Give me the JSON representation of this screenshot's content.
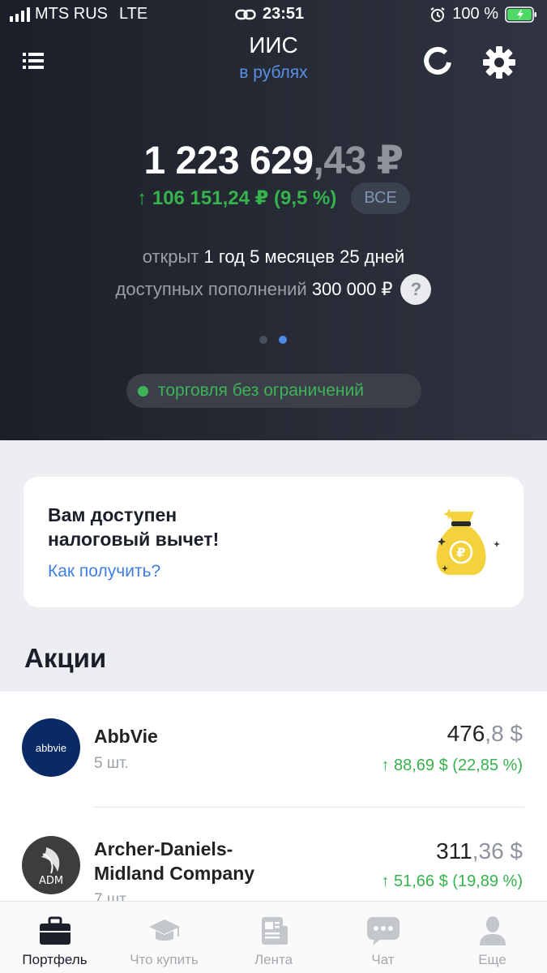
{
  "status_bar": {
    "carrier": "MTS RUS",
    "network": "LTE",
    "time": "23:51",
    "battery": "100 %"
  },
  "header": {
    "title": "ИИС",
    "subtitle": "в рублях"
  },
  "balance": {
    "main": "1 223 629",
    "fraction": ",43 ₽"
  },
  "change": {
    "text": "↑ 106 151,24 ₽ (9,5 %)",
    "button_label": "ВСЕ"
  },
  "account_info": {
    "opened_label": "открыт",
    "opened_value": "1 год 5 месяцев 25 дней",
    "deposits_label": "доступных пополнений",
    "deposits_value": "300 000 ₽",
    "help": "?"
  },
  "pager": {
    "pages": 2,
    "active": 2
  },
  "trading_status": "торговля без ограничений",
  "tax_card": {
    "title_line1": "Вам доступен",
    "title_line2": "налоговый вычет!",
    "link": "Как получить?"
  },
  "section": {
    "title": "Акции"
  },
  "stocks": [
    {
      "name": "AbbVie",
      "logo_text": "abbvie",
      "qty": "5 шт.",
      "price_int": "476",
      "price_frac": ",8 $",
      "gain": "↑ 88,69 $ (22,85 %)"
    },
    {
      "name_line1": "Archer-Daniels-",
      "name_line2": "Midland Company",
      "logo_text": "ADM",
      "qty": "7 шт.",
      "price_int": "311",
      "price_frac": ",36 $",
      "gain": "↑ 51,66 $ (19,89 %)"
    }
  ],
  "tabs": [
    {
      "label": "Портфель",
      "icon": "briefcase-icon",
      "active": true
    },
    {
      "label": "Что купить",
      "icon": "graduation-cap-icon"
    },
    {
      "label": "Лента",
      "icon": "newspaper-icon"
    },
    {
      "label": "Чат",
      "icon": "chat-bubble-icon"
    },
    {
      "label": "Еще",
      "icon": "user-icon"
    }
  ],
  "colors": {
    "accent_blue": "#5b8fe6",
    "positive_green": "#36b34c",
    "header_bg": "#1f2330"
  }
}
